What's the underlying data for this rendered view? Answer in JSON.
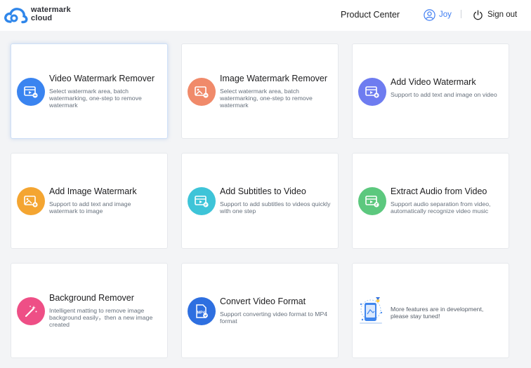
{
  "header": {
    "logo_line1": "watermark",
    "logo_line2": "cloud",
    "product_center": "Product Center",
    "user_name": "Joy",
    "sign_out": "Sign out"
  },
  "colors": {
    "accent": "#3d7cf2",
    "blue_icon": "#3a84f0",
    "orange_icon": "#f08a6a",
    "purple_icon": "#6e7cf0",
    "yellow_icon": "#f4a531",
    "cyan_icon": "#3ec4d8",
    "green_icon": "#5cc87e",
    "pink_icon": "#ee4f86",
    "deep_blue_icon": "#2e6fe0"
  },
  "cards": [
    {
      "title": "Video Watermark Remover",
      "desc": "Select watermark area, batch watermarking, one-step to remove watermark",
      "icon": "video-watermark-remove-icon"
    },
    {
      "title": "Image Watermark Remover",
      "desc": "Select watermark area, batch watermarking, one-step to remove watermark",
      "icon": "image-watermark-remove-icon"
    },
    {
      "title": "Add Video Watermark",
      "desc": "Support to add text and image on video",
      "icon": "video-watermark-add-icon"
    },
    {
      "title": "Add Image Watermark",
      "desc": "Support to add text and image watermark to image",
      "icon": "image-watermark-add-icon"
    },
    {
      "title": "Add Subtitles to Video",
      "desc": "Support to add subtitles to videos quickly with one step",
      "icon": "subtitles-icon"
    },
    {
      "title": "Extract Audio from Video",
      "desc": "Support audio separation from video, automatically recognize video music",
      "icon": "extract-audio-icon"
    },
    {
      "title": "Background Remover",
      "desc": "Intelligent matting to remove image background easily，then a new image created",
      "icon": "magic-wand-icon"
    },
    {
      "title": "Convert Video Format",
      "desc": "Support converting video format to MP4 format",
      "icon": "mp4-file-icon",
      "icon_text": "MP4"
    },
    {
      "desc": "More features are in development, please stay tuned!",
      "icon": "in-development-illustration"
    }
  ]
}
